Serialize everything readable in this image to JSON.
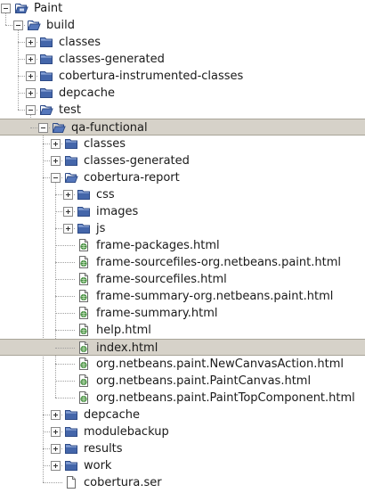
{
  "colors": {
    "selection_background": "#d6d2c9",
    "selection_border": "#a9a498",
    "folder_blue": "#4466aa",
    "html_icon_green": "#3f8a3a"
  },
  "tree": {
    "nodes": [
      {
        "label": "Paint",
        "depth": 0,
        "icon": "project-folder-open-icon",
        "toggle": "expanded"
      },
      {
        "label": "build",
        "depth": 1,
        "icon": "folder-open-icon",
        "toggle": "expanded"
      },
      {
        "label": "classes",
        "depth": 2,
        "icon": "folder-closed-icon",
        "toggle": "collapsed"
      },
      {
        "label": "classes-generated",
        "depth": 2,
        "icon": "folder-closed-icon",
        "toggle": "collapsed"
      },
      {
        "label": "cobertura-instrumented-classes",
        "depth": 2,
        "icon": "folder-closed-icon",
        "toggle": "collapsed"
      },
      {
        "label": "depcache",
        "depth": 2,
        "icon": "folder-closed-icon",
        "toggle": "collapsed"
      },
      {
        "label": "test",
        "depth": 2,
        "icon": "folder-open-icon",
        "toggle": "expanded"
      },
      {
        "label": "qa-functional",
        "depth": 3,
        "icon": "folder-open-icon",
        "toggle": "expanded",
        "selected": true
      },
      {
        "label": "classes",
        "depth": 4,
        "icon": "folder-closed-icon",
        "toggle": "collapsed"
      },
      {
        "label": "classes-generated",
        "depth": 4,
        "icon": "folder-closed-icon",
        "toggle": "collapsed"
      },
      {
        "label": "cobertura-report",
        "depth": 4,
        "icon": "folder-open-icon",
        "toggle": "expanded"
      },
      {
        "label": "css",
        "depth": 5,
        "icon": "folder-closed-icon",
        "toggle": "collapsed"
      },
      {
        "label": "images",
        "depth": 5,
        "icon": "folder-closed-icon",
        "toggle": "collapsed"
      },
      {
        "label": "js",
        "depth": 5,
        "icon": "folder-closed-icon",
        "toggle": "collapsed"
      },
      {
        "label": "frame-packages.html",
        "depth": 5,
        "icon": "html-file-icon",
        "toggle": "none"
      },
      {
        "label": "frame-sourcefiles-org.netbeans.paint.html",
        "depth": 5,
        "icon": "html-file-icon",
        "toggle": "none"
      },
      {
        "label": "frame-sourcefiles.html",
        "depth": 5,
        "icon": "html-file-icon",
        "toggle": "none"
      },
      {
        "label": "frame-summary-org.netbeans.paint.html",
        "depth": 5,
        "icon": "html-file-icon",
        "toggle": "none"
      },
      {
        "label": "frame-summary.html",
        "depth": 5,
        "icon": "html-file-icon",
        "toggle": "none"
      },
      {
        "label": "help.html",
        "depth": 5,
        "icon": "html-file-icon",
        "toggle": "none"
      },
      {
        "label": "index.html",
        "depth": 5,
        "icon": "html-file-icon",
        "toggle": "none",
        "selected": true
      },
      {
        "label": "org.netbeans.paint.NewCanvasAction.html",
        "depth": 5,
        "icon": "html-file-icon",
        "toggle": "none"
      },
      {
        "label": "org.netbeans.paint.PaintCanvas.html",
        "depth": 5,
        "icon": "html-file-icon",
        "toggle": "none"
      },
      {
        "label": "org.netbeans.paint.PaintTopComponent.html",
        "depth": 5,
        "icon": "html-file-icon",
        "toggle": "none"
      },
      {
        "label": "depcache",
        "depth": 4,
        "icon": "folder-closed-icon",
        "toggle": "collapsed"
      },
      {
        "label": "modulebackup",
        "depth": 4,
        "icon": "folder-closed-icon",
        "toggle": "collapsed"
      },
      {
        "label": "results",
        "depth": 4,
        "icon": "folder-closed-icon",
        "toggle": "collapsed"
      },
      {
        "label": "work",
        "depth": 4,
        "icon": "folder-closed-icon",
        "toggle": "collapsed"
      },
      {
        "label": "cobertura.ser",
        "depth": 4,
        "icon": "file-icon",
        "toggle": "none"
      }
    ]
  }
}
